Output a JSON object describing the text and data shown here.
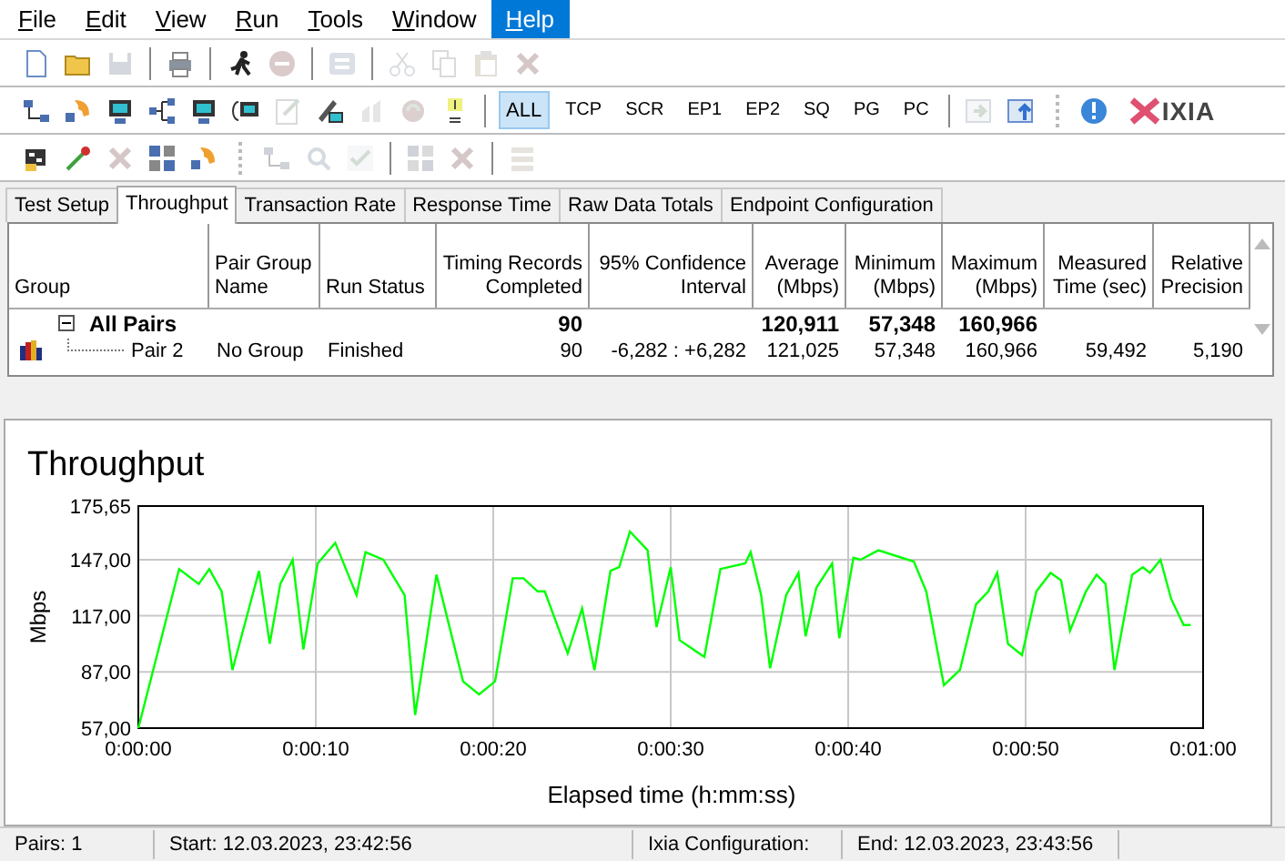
{
  "menu": [
    {
      "label": "File",
      "selected": false
    },
    {
      "label": "Edit",
      "selected": false
    },
    {
      "label": "View",
      "selected": false
    },
    {
      "label": "Run",
      "selected": false
    },
    {
      "label": "Tools",
      "selected": false
    },
    {
      "label": "Window",
      "selected": false
    },
    {
      "label": "Help",
      "selected": true
    }
  ],
  "toolbars": [
    {
      "items": [
        {
          "kind": "icon",
          "disabled": false
        },
        {
          "kind": "icon",
          "disabled": false
        },
        {
          "kind": "icon",
          "disabled": true
        },
        {
          "kind": "separator"
        },
        {
          "kind": "icon",
          "disabled": false
        },
        {
          "kind": "separator"
        },
        {
          "kind": "icon",
          "disabled": false
        },
        {
          "kind": "icon",
          "disabled": true
        },
        {
          "kind": "separator"
        },
        {
          "kind": "icon",
          "disabled": true
        },
        {
          "kind": "separator"
        },
        {
          "kind": "icon",
          "disabled": true
        },
        {
          "kind": "icon",
          "disabled": true
        },
        {
          "kind": "icon",
          "disabled": true
        },
        {
          "kind": "icon",
          "disabled": true
        }
      ]
    },
    {
      "items": [
        {
          "kind": "icon",
          "disabled": false
        },
        {
          "kind": "icon",
          "disabled": false
        },
        {
          "kind": "icon",
          "disabled": false
        },
        {
          "kind": "icon",
          "disabled": false
        },
        {
          "kind": "icon",
          "disabled": false
        },
        {
          "kind": "icon",
          "disabled": false
        },
        {
          "kind": "icon",
          "disabled": true
        },
        {
          "kind": "icon",
          "disabled": false
        },
        {
          "kind": "icon",
          "disabled": true
        },
        {
          "kind": "icon",
          "disabled": true
        },
        {
          "kind": "icon",
          "disabled": false
        },
        {
          "kind": "separator"
        },
        {
          "kind": "filter",
          "label": "ALL",
          "selected": true
        },
        {
          "kind": "filter",
          "label": "TCP",
          "selected": false
        },
        {
          "kind": "filter",
          "label": "SCR",
          "selected": false
        },
        {
          "kind": "filter",
          "label": "EP1",
          "selected": false
        },
        {
          "kind": "filter",
          "label": "EP2",
          "selected": false
        },
        {
          "kind": "filter",
          "label": "SQ",
          "selected": false
        },
        {
          "kind": "filter",
          "label": "PG",
          "selected": false
        },
        {
          "kind": "filter",
          "label": "PC",
          "selected": false
        },
        {
          "kind": "separator"
        },
        {
          "kind": "icon",
          "disabled": true
        },
        {
          "kind": "icon",
          "disabled": false
        },
        {
          "kind": "grip"
        },
        {
          "kind": "icon",
          "disabled": false
        },
        {
          "kind": "logo",
          "label": "IXIA"
        }
      ]
    },
    {
      "items": [
        {
          "kind": "icon",
          "disabled": false
        },
        {
          "kind": "icon",
          "disabled": false
        },
        {
          "kind": "icon",
          "disabled": true
        },
        {
          "kind": "icon",
          "disabled": false
        },
        {
          "kind": "icon",
          "disabled": false
        },
        {
          "kind": "grip"
        },
        {
          "kind": "icon",
          "disabled": true
        },
        {
          "kind": "icon",
          "disabled": true
        },
        {
          "kind": "icon",
          "disabled": true
        },
        {
          "kind": "separator"
        },
        {
          "kind": "icon",
          "disabled": true
        },
        {
          "kind": "icon",
          "disabled": true
        },
        {
          "kind": "separator"
        },
        {
          "kind": "icon",
          "disabled": true
        }
      ]
    }
  ],
  "tabs": [
    {
      "label": "Test Setup",
      "selected": false
    },
    {
      "label": "Throughput",
      "selected": true
    },
    {
      "label": "Transaction Rate",
      "selected": false
    },
    {
      "label": "Response Time",
      "selected": false
    },
    {
      "label": "Raw Data Totals",
      "selected": false
    },
    {
      "label": "Endpoint Configuration",
      "selected": false
    }
  ],
  "table": {
    "columns": [
      {
        "label": "Group"
      },
      {
        "label": "Pair Group\nName"
      },
      {
        "label": "Run Status"
      },
      {
        "label": "Timing Records\nCompleted"
      },
      {
        "label": "95% Confidence\nInterval"
      },
      {
        "label": "Average\n(Mbps)"
      },
      {
        "label": "Minimum\n(Mbps)"
      },
      {
        "label": "Maximum\n(Mbps)"
      },
      {
        "label": "Measured\nTime (sec)"
      },
      {
        "label": "Relative\nPrecision"
      }
    ],
    "rows": [
      {
        "expanded": true,
        "cells": [
          "All Pairs",
          "",
          "",
          "90",
          "",
          "120,911",
          "57,348",
          "160,966",
          "",
          ""
        ],
        "children": [
          {
            "cells": [
              "Pair 2",
              "No Group",
              "Finished",
              "90",
              "-6,282 : +6,282",
              "121,025",
              "57,348",
              "160,966",
              "59,492",
              "5,190"
            ]
          }
        ]
      }
    ]
  },
  "chart": {
    "chart_data": {
      "type": "line",
      "title": "Throughput",
      "xlabel": "Elapsed time (h:mm:ss)",
      "ylabel": "Mbps",
      "x": [
        0,
        2.3,
        3.4,
        4,
        4.7,
        5.3,
        6.8,
        7.4,
        8,
        8.7,
        9.3,
        10.1,
        11.1,
        12.3,
        12.8,
        13.8,
        15,
        15.6,
        16.8,
        18.3,
        19.2,
        20.1,
        21.1,
        21.7,
        22.5,
        22.9,
        24.2,
        25,
        25.7,
        26.6,
        27.1,
        27.7,
        28.7,
        29.2,
        30,
        30.5,
        31.9,
        32.8,
        34.2,
        34.5,
        35.1,
        35.6,
        36.5,
        37.2,
        37.6,
        38.2,
        39.1,
        39.5,
        40.3,
        40.7,
        41.7,
        43.7,
        44.4,
        45.4,
        46.3,
        47.2,
        47.9,
        48.4,
        49,
        49.8,
        50.6,
        51.4,
        52,
        52.5,
        53.4,
        54,
        54.5,
        55,
        56,
        56.6,
        57,
        57.6,
        58.2,
        58.9,
        59.3
      ],
      "series": [
        {
          "color": "#00ff00",
          "values": [
            57,
            142,
            134,
            142,
            130,
            88,
            141,
            102,
            134,
            147,
            99,
            145,
            156,
            128,
            151,
            147,
            128,
            64,
            139,
            82,
            75,
            82,
            137,
            137,
            130,
            130,
            97,
            121,
            88,
            141,
            143,
            162,
            152,
            111,
            143,
            104,
            95,
            142,
            145,
            151,
            128,
            89,
            128,
            140,
            106,
            132,
            145,
            105,
            148,
            147,
            152,
            146,
            130,
            80,
            88,
            123,
            130,
            140,
            102,
            96,
            130,
            140,
            136,
            109,
            130,
            139,
            134,
            88,
            139,
            143,
            140,
            147,
            126,
            112,
            112
          ]
        }
      ],
      "grid": true,
      "xlim": [
        0,
        60
      ],
      "ylim": [
        57,
        175.65
      ],
      "xticks": [
        {
          "value": 0,
          "label": "0:00:00"
        },
        {
          "value": 10,
          "label": "0:00:10"
        },
        {
          "value": 20,
          "label": "0:00:20"
        },
        {
          "value": 30,
          "label": "0:00:30"
        },
        {
          "value": 40,
          "label": "0:00:40"
        },
        {
          "value": 50,
          "label": "0:00:50"
        },
        {
          "value": 60,
          "label": "0:01:00"
        }
      ],
      "yticks": [
        {
          "value": 57,
          "label": "57,00"
        },
        {
          "value": 87,
          "label": "87,00"
        },
        {
          "value": 117,
          "label": "117,00"
        },
        {
          "value": 147,
          "label": "147,00"
        },
        {
          "value": 175.65,
          "label": "175,65"
        }
      ]
    }
  },
  "status_bar": [
    "Pairs: 1",
    "Start: 12.03.2023, 23:42:56",
    "Ixia Configuration:",
    "End: 12.03.2023, 23:43:56"
  ]
}
